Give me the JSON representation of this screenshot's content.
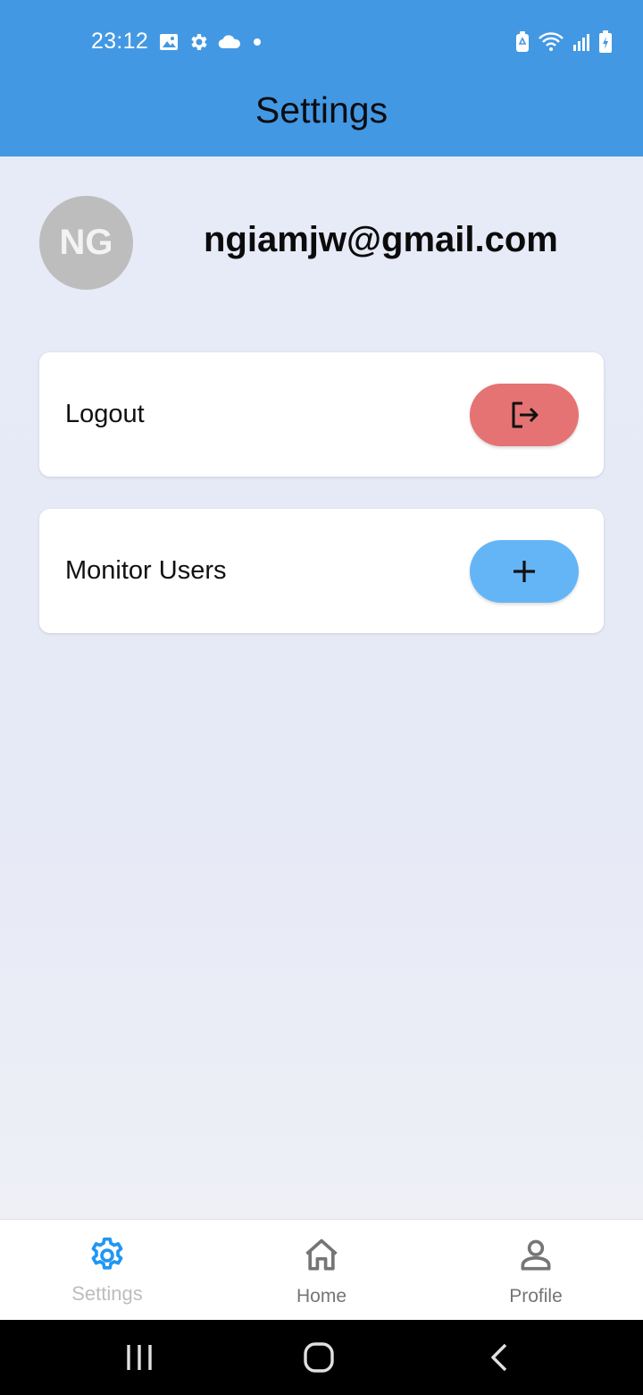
{
  "status_bar": {
    "time": "23:12",
    "left_icons": [
      "gallery-icon",
      "settings-gear-icon",
      "cloud-icon",
      "notification-dot-icon"
    ],
    "right_icons": [
      "battery-saver-icon",
      "wifi-icon",
      "signal-icon",
      "battery-charging-icon"
    ]
  },
  "app_bar": {
    "title": "Settings",
    "color": "#4398e3"
  },
  "profile": {
    "avatar_initials": "NG",
    "email": "ngiamjw@gmail.com"
  },
  "cards": [
    {
      "label": "Logout",
      "button_icon": "logout-icon",
      "button_color": "#e57373"
    },
    {
      "label": "Monitor Users",
      "button_icon": "plus-icon",
      "button_color": "#64b5f6"
    }
  ],
  "bottom_nav": {
    "items": [
      {
        "label": "Settings",
        "icon": "gear-icon",
        "active": true
      },
      {
        "label": "Home",
        "icon": "home-icon",
        "active": false
      },
      {
        "label": "Profile",
        "icon": "person-icon",
        "active": false
      }
    ],
    "active_color": "#2196f3",
    "inactive_color": "#757575"
  },
  "system_nav": {
    "icons": [
      "recents-icon",
      "home-circle-icon",
      "back-icon"
    ]
  }
}
